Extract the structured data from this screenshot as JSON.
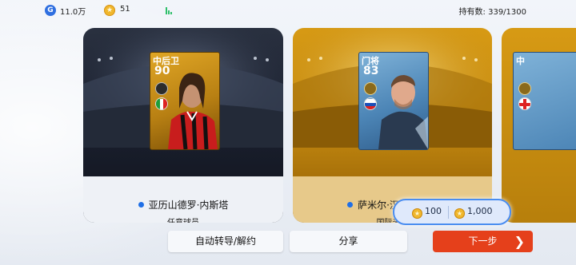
{
  "topbar": {
    "gp_icon": "G",
    "gp_value": "11.0万",
    "coin_value": "51",
    "owned_text": "持有数: 339/1300"
  },
  "cards": [
    {
      "position": "中后卫",
      "rating": "90",
      "name": "亚历山德罗·内斯塔",
      "sublabel": "任意球员",
      "flag": "Italy",
      "style": "gold-card"
    },
    {
      "position": "门将",
      "rating": "83",
      "name": "萨米尔·汉达诺维奇",
      "sublabel": "国际米兰",
      "flag": "Slovenia",
      "style": "blue-card"
    },
    {
      "position": "中",
      "rating": "",
      "name": "",
      "sublabel": "",
      "style": "blue-card"
    }
  ],
  "price": {
    "option1": "100",
    "option2": "1,000"
  },
  "buttons": {
    "auto_convert": "自动转导/解约",
    "share": "分享",
    "next": "下一步"
  },
  "colors": {
    "accent_red": "#e5401b",
    "name_dot": "#1f6fe6",
    "gold": "#d79a14",
    "popup_border": "#4a8df0"
  },
  "icons": [
    "gp-icon",
    "coin-icon",
    "signal-icon",
    "club-badge-icon",
    "flag-icon",
    "chevron-right-icon"
  ]
}
